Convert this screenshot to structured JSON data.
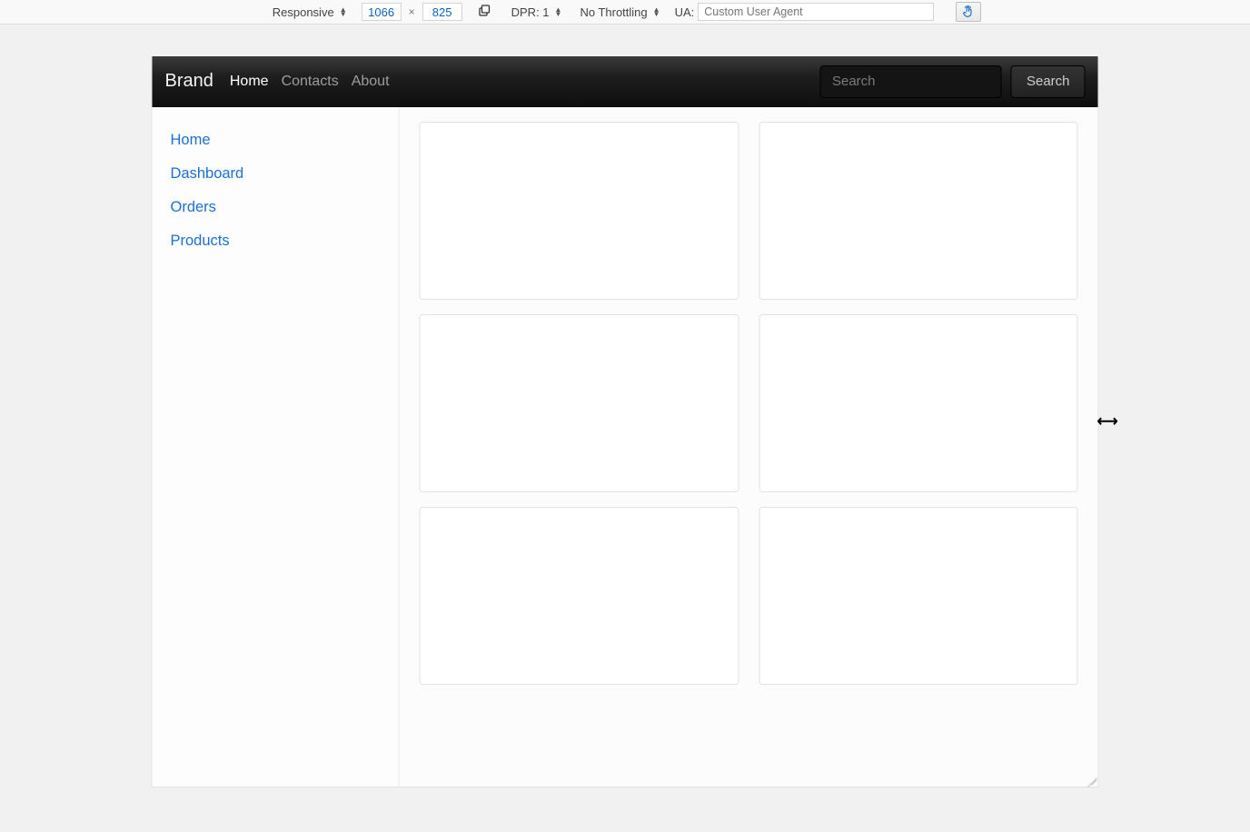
{
  "rdm": {
    "device": "Responsive",
    "width": "1066",
    "height": "825",
    "dpr_label": "DPR: 1",
    "throttling": "No Throttling",
    "ua_label": "UA:",
    "ua_placeholder": "Custom User Agent"
  },
  "navbar": {
    "brand": "Brand",
    "links": [
      "Home",
      "Contacts",
      "About"
    ],
    "active_index": 0,
    "search_placeholder": "Search",
    "search_button": "Search"
  },
  "sidebar": {
    "items": [
      "Home",
      "Dashboard",
      "Orders",
      "Products"
    ]
  },
  "cards_count": 6
}
